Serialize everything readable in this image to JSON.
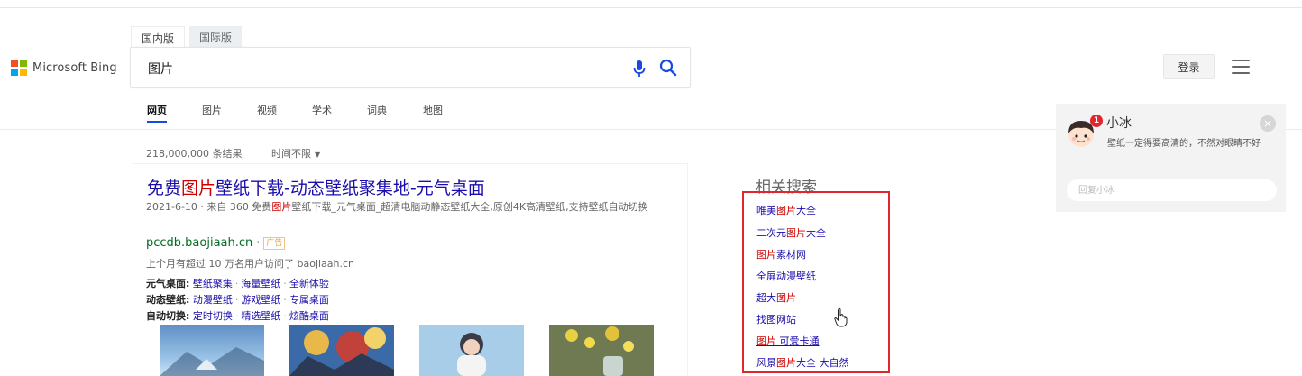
{
  "brand": {
    "logo_text": "Microsoft Bing",
    "logo_colors": [
      "#f25022",
      "#7fba00",
      "#00a4ef",
      "#ffb900"
    ]
  },
  "version_tabs": [
    {
      "label": "国内版",
      "active": true
    },
    {
      "label": "国际版",
      "active": false
    }
  ],
  "search": {
    "query": "图片",
    "mic_icon": "microphone-icon",
    "search_icon": "magnifier-icon",
    "accent_color": "#174ae4"
  },
  "scopes": [
    {
      "label": "网页",
      "active": true
    },
    {
      "label": "图片",
      "active": false
    },
    {
      "label": "视频",
      "active": false
    },
    {
      "label": "学术",
      "active": false
    },
    {
      "label": "词典",
      "active": false
    },
    {
      "label": "地图",
      "active": false
    }
  ],
  "header_right": {
    "login_label": "登录",
    "menu_icon": "hamburger-menu-icon"
  },
  "results_meta": {
    "count": "218,000,000 条结果",
    "time_filter": "时间不限"
  },
  "result": {
    "title_parts": [
      "免费",
      "图片",
      "壁纸下载-动态壁纸聚集地-元气桌面"
    ],
    "snippet_parts": [
      "2021-6-10 · 来自 360 免费",
      "图片",
      "壁纸下载_元气桌面_超清电脑动静态壁纸大全,原创4K高清壁纸,支持壁纸自动切换"
    ],
    "url": "pccdb.baojiaah.cn",
    "ad_label": "广告",
    "visits": "上个月有超过 10 万名用户访问了 baojiaah.cn",
    "sitelinks": [
      {
        "label": "元气桌面:",
        "links": [
          "壁纸聚集",
          "海量壁纸",
          "全新体验"
        ]
      },
      {
        "label": "动态壁纸:",
        "links": [
          "动漫壁纸",
          "游戏壁纸",
          "专属桌面"
        ]
      },
      {
        "label": "自动切换:",
        "links": [
          "定时切换",
          "精选壁纸",
          "炫酷桌面"
        ]
      }
    ]
  },
  "related": {
    "title": "相关搜索",
    "highlight_color": "#e0272d",
    "items": [
      {
        "parts": [
          "唯美",
          "图片",
          "大全"
        ]
      },
      {
        "parts": [
          "二次元",
          "图片",
          "大全"
        ]
      },
      {
        "parts": [
          "",
          "图片",
          "素材网"
        ]
      },
      {
        "parts": [
          "全屏动漫壁纸",
          "",
          ""
        ]
      },
      {
        "parts": [
          "超大",
          "图片",
          ""
        ]
      },
      {
        "parts": [
          "找图网站",
          "",
          ""
        ]
      },
      {
        "parts": [
          "",
          "图片",
          " 可爱卡通"
        ]
      },
      {
        "parts": [
          "风景",
          "图片",
          "大全 大自然"
        ]
      }
    ]
  },
  "chat": {
    "name": "小冰",
    "badge_count": "1",
    "message": "壁纸一定得要高清的，不然对眼睛不好",
    "input_placeholder": "回复小冰"
  }
}
